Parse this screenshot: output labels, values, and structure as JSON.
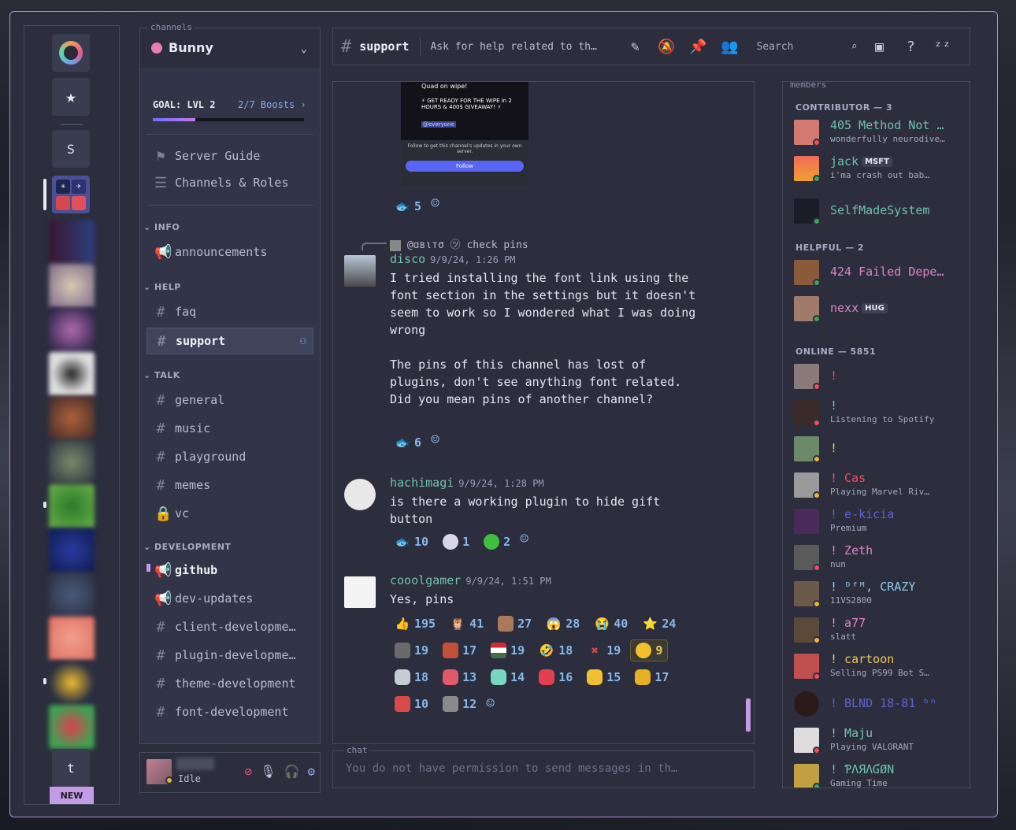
{
  "rail": {
    "servers": [
      "S",
      "t"
    ],
    "new_badge": "NEW"
  },
  "channels_label": "channels",
  "guild": {
    "name": "Bunny"
  },
  "boost": {
    "goal": "GOAL: LVL 2",
    "progress": "2/7 Boosts",
    "fill_fraction": 0.28
  },
  "guide": [
    {
      "label": "Server Guide",
      "icon": "signpost-icon"
    },
    {
      "label": "Channels & Roles",
      "icon": "channel-browse-icon"
    }
  ],
  "categories": {
    "info": "INFO",
    "help": "HELP",
    "talk": "TALK",
    "development": "DEVELOPMENT"
  },
  "channels": {
    "announcements": "announcements",
    "faq": "faq",
    "support": "support",
    "general": "general",
    "music": "music",
    "playground": "playground",
    "memes": "memes",
    "vc": "vc",
    "github": "github",
    "dev_updates": "dev-updates",
    "client_dev": "client-developme…",
    "plugin_dev": "plugin-developme…",
    "theme_dev": "theme-development",
    "font_dev": "font-development"
  },
  "user": {
    "status": "Idle"
  },
  "header": {
    "channel": "support",
    "topic": "Ask for help related to th…",
    "search": "Search"
  },
  "embed": {
    "line1": "Quad on wipe!",
    "line2": "⚡ GET READY FOR THE WIPE in 2 HOURS & 400$ GIVEAWAY! ⚡",
    "mention": "@everyone",
    "follow_text": "Follow to get this channel's updates in your own server.",
    "follow_button": "Follow"
  },
  "messages": {
    "m0_react_count": "5",
    "reply": {
      "author": "@ɑвιтσ",
      "text": "check pins"
    },
    "m1": {
      "author": "disco",
      "time": "9/9/24, 1:26 PM",
      "text": "I tried installing the font link using the font section in the settings but it doesn't seem to work so I wondered what I was doing wrong\n\nThe pins of this channel has lost of plugins, don't see anything font related. Did you mean pins of another channel?",
      "react_count": "6"
    },
    "m2": {
      "author": "hachimagi",
      "time": "9/9/24, 1:28 PM",
      "text": "is there a working plugin to hide gift button",
      "reacts": [
        "10",
        "1",
        "2"
      ]
    },
    "m3": {
      "author": "cooolgamer",
      "time": "9/9/24, 1:51 PM",
      "text": "Yes, pins",
      "reacts": [
        "195",
        "41",
        "27",
        "28",
        "40",
        "24",
        "19",
        "17",
        "19",
        "18",
        "19",
        "9",
        "18",
        "13",
        "14",
        "16",
        "15",
        "17",
        "10",
        "12"
      ]
    }
  },
  "input": {
    "label": "chat",
    "placeholder": "You do not have permission to send messages in th…"
  },
  "members": {
    "label": "members",
    "contributor": "CONTRIBUTOR — 3",
    "helpful": "HELPFUL — 2",
    "online": "ONLINE — 5851",
    "list": [
      {
        "name": "405 Method Not …",
        "status": "wonderfully neurodive…",
        "color": "#6fc3a8"
      },
      {
        "name": "jack",
        "tag": "MSFT",
        "status": "i'ma crash out bab…",
        "color": "#6fc3a8"
      },
      {
        "name": "SelfMadeSystem",
        "status": "",
        "color": "#6fc3a8"
      },
      {
        "name": "424 Failed Depe…",
        "status": "",
        "color": "#e184c6"
      },
      {
        "name": "nexx",
        "tag": "HUG",
        "status": "",
        "color": "#e184c6"
      },
      {
        "name": "!",
        "status": "",
        "color": "#f04d5a"
      },
      {
        "name": "!",
        "status": "Listening to Spotify",
        "color": "#6fc3a8"
      },
      {
        "name": "!",
        "status": "",
        "color": "#f0c85a"
      },
      {
        "name": "! Cas",
        "status": "Playing Marvel Riv…",
        "color": "#f04d5a"
      },
      {
        "name": "! e-kicia",
        "status": "Premium",
        "color": "#5b62d6"
      },
      {
        "name": "! Zeth",
        "status": "nun",
        "color": "#e184c6"
      },
      {
        "name": "! ᴰᶠᴹ, CRAZY",
        "status": "11VS2800",
        "color": "#8fc9e8"
      },
      {
        "name": "! a77",
        "status": "slatt",
        "color": "#e184c6"
      },
      {
        "name": "! cartoon",
        "status": "Selling PS99 Bot S…",
        "color": "#f0c85a"
      },
      {
        "name": "! BLND 18-81 ᵇʰ",
        "status": "",
        "color": "#5b62d6"
      },
      {
        "name": "! Maju",
        "status": "Playing VALORANT",
        "color": "#6fc3a8"
      },
      {
        "name": "! ƤΛЯΛƓØN",
        "status": "Gaming Time",
        "color": "#6fc3a8"
      }
    ]
  }
}
